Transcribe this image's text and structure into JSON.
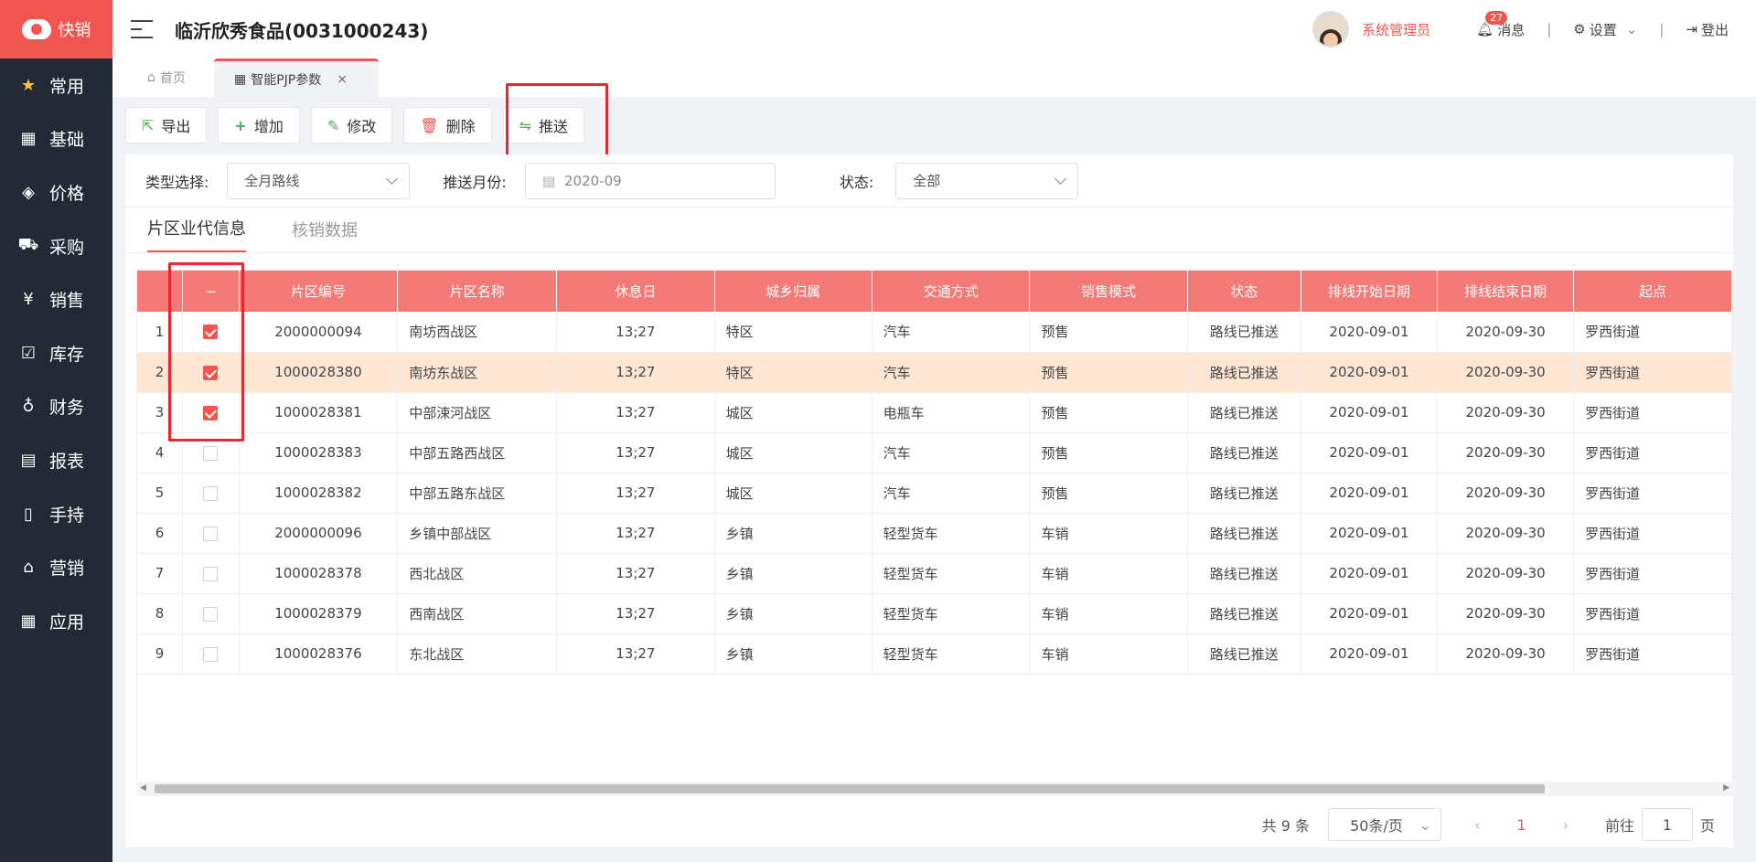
{
  "app": {
    "logo_text": "快销"
  },
  "sidebar": {
    "items": [
      {
        "label": "常用",
        "icon": "star-icon"
      },
      {
        "label": "基础",
        "icon": "grid-icon"
      },
      {
        "label": "价格",
        "icon": "tag-icon"
      },
      {
        "label": "采购",
        "icon": "cart-icon"
      },
      {
        "label": "销售",
        "icon": "yen-icon"
      },
      {
        "label": "库存",
        "icon": "checkbox-icon"
      },
      {
        "label": "财务",
        "icon": "moneybag-icon"
      },
      {
        "label": "报表",
        "icon": "report-icon"
      },
      {
        "label": "手持",
        "icon": "handheld-icon"
      },
      {
        "label": "营销",
        "icon": "store-icon"
      },
      {
        "label": "应用",
        "icon": "apps-icon"
      }
    ]
  },
  "header": {
    "company": "临沂欣秀食品(0031000243)",
    "user": "系统管理员",
    "msg_label": "消息",
    "msg_count": "27",
    "settings_label": "设置",
    "logout_label": "登出",
    "separator": "|"
  },
  "tabs": {
    "home": "首页",
    "current": "智能PJP参数",
    "close": "×"
  },
  "toolbar": {
    "export": "导出",
    "add": "增加",
    "edit": "修改",
    "delete": "删除",
    "push": "推送"
  },
  "filters": {
    "type_label": "类型选择:",
    "type_value": "全月路线",
    "month_label": "推送月份:",
    "month_value": "2020-09",
    "status_label": "状态:",
    "status_value": "全部"
  },
  "subtabs": {
    "active": "片区业代信息",
    "other": "核销数据"
  },
  "table": {
    "select_all": "−",
    "columns": [
      "片区编号",
      "片区名称",
      "休息日",
      "城乡归属",
      "交通方式",
      "销售模式",
      "状态",
      "排线开始日期",
      "排线结束日期",
      "起点"
    ],
    "rows": [
      {
        "idx": "1",
        "code": "2000000094",
        "name": "南坊西战区",
        "rest": "13;27",
        "area": "特区",
        "traffic": "汽车",
        "mode": "预售",
        "status": "路线已推送",
        "start": "2020-09-01",
        "end": "2020-09-30",
        "origin": "罗西街道"
      },
      {
        "idx": "2",
        "code": "1000028380",
        "name": "南坊东战区",
        "rest": "13;27",
        "area": "特区",
        "traffic": "汽车",
        "mode": "预售",
        "status": "路线已推送",
        "start": "2020-09-01",
        "end": "2020-09-30",
        "origin": "罗西街道"
      },
      {
        "idx": "3",
        "code": "1000028381",
        "name": "中部涑河战区",
        "rest": "13;27",
        "area": "城区",
        "traffic": "电瓶车",
        "mode": "预售",
        "status": "路线已推送",
        "start": "2020-09-01",
        "end": "2020-09-30",
        "origin": "罗西街道"
      },
      {
        "idx": "4",
        "code": "1000028383",
        "name": "中部五路西战区",
        "rest": "13;27",
        "area": "城区",
        "traffic": "汽车",
        "mode": "预售",
        "status": "路线已推送",
        "start": "2020-09-01",
        "end": "2020-09-30",
        "origin": "罗西街道"
      },
      {
        "idx": "5",
        "code": "1000028382",
        "name": "中部五路东战区",
        "rest": "13;27",
        "area": "城区",
        "traffic": "汽车",
        "mode": "预售",
        "status": "路线已推送",
        "start": "2020-09-01",
        "end": "2020-09-30",
        "origin": "罗西街道"
      },
      {
        "idx": "6",
        "code": "2000000096",
        "name": "乡镇中部战区",
        "rest": "13;27",
        "area": "乡镇",
        "traffic": "轻型货车",
        "mode": "车销",
        "status": "路线已推送",
        "start": "2020-09-01",
        "end": "2020-09-30",
        "origin": "罗西街道"
      },
      {
        "idx": "7",
        "code": "1000028378",
        "name": "西北战区",
        "rest": "13;27",
        "area": "乡镇",
        "traffic": "轻型货车",
        "mode": "车销",
        "status": "路线已推送",
        "start": "2020-09-01",
        "end": "2020-09-30",
        "origin": "罗西街道"
      },
      {
        "idx": "8",
        "code": "1000028379",
        "name": "西南战区",
        "rest": "13;27",
        "area": "乡镇",
        "traffic": "轻型货车",
        "mode": "车销",
        "status": "路线已推送",
        "start": "2020-09-01",
        "end": "2020-09-30",
        "origin": "罗西街道"
      },
      {
        "idx": "9",
        "code": "1000028376",
        "name": "东北战区",
        "rest": "13;27",
        "area": "乡镇",
        "traffic": "轻型货车",
        "mode": "车销",
        "status": "路线已推送",
        "start": "2020-09-01",
        "end": "2020-09-30",
        "origin": "罗西街道"
      }
    ]
  },
  "pagination": {
    "total": "共 9 条",
    "page_size": "50条/页",
    "current": "1",
    "goto_label": "前往",
    "goto_value": "1",
    "page_suffix": "页"
  },
  "colors": {
    "brand": "#f0554f",
    "sidebar": "#232a36",
    "header_row": "#f47a78",
    "highlight_row": "#fde6d3",
    "annotation": "#e8272f"
  }
}
